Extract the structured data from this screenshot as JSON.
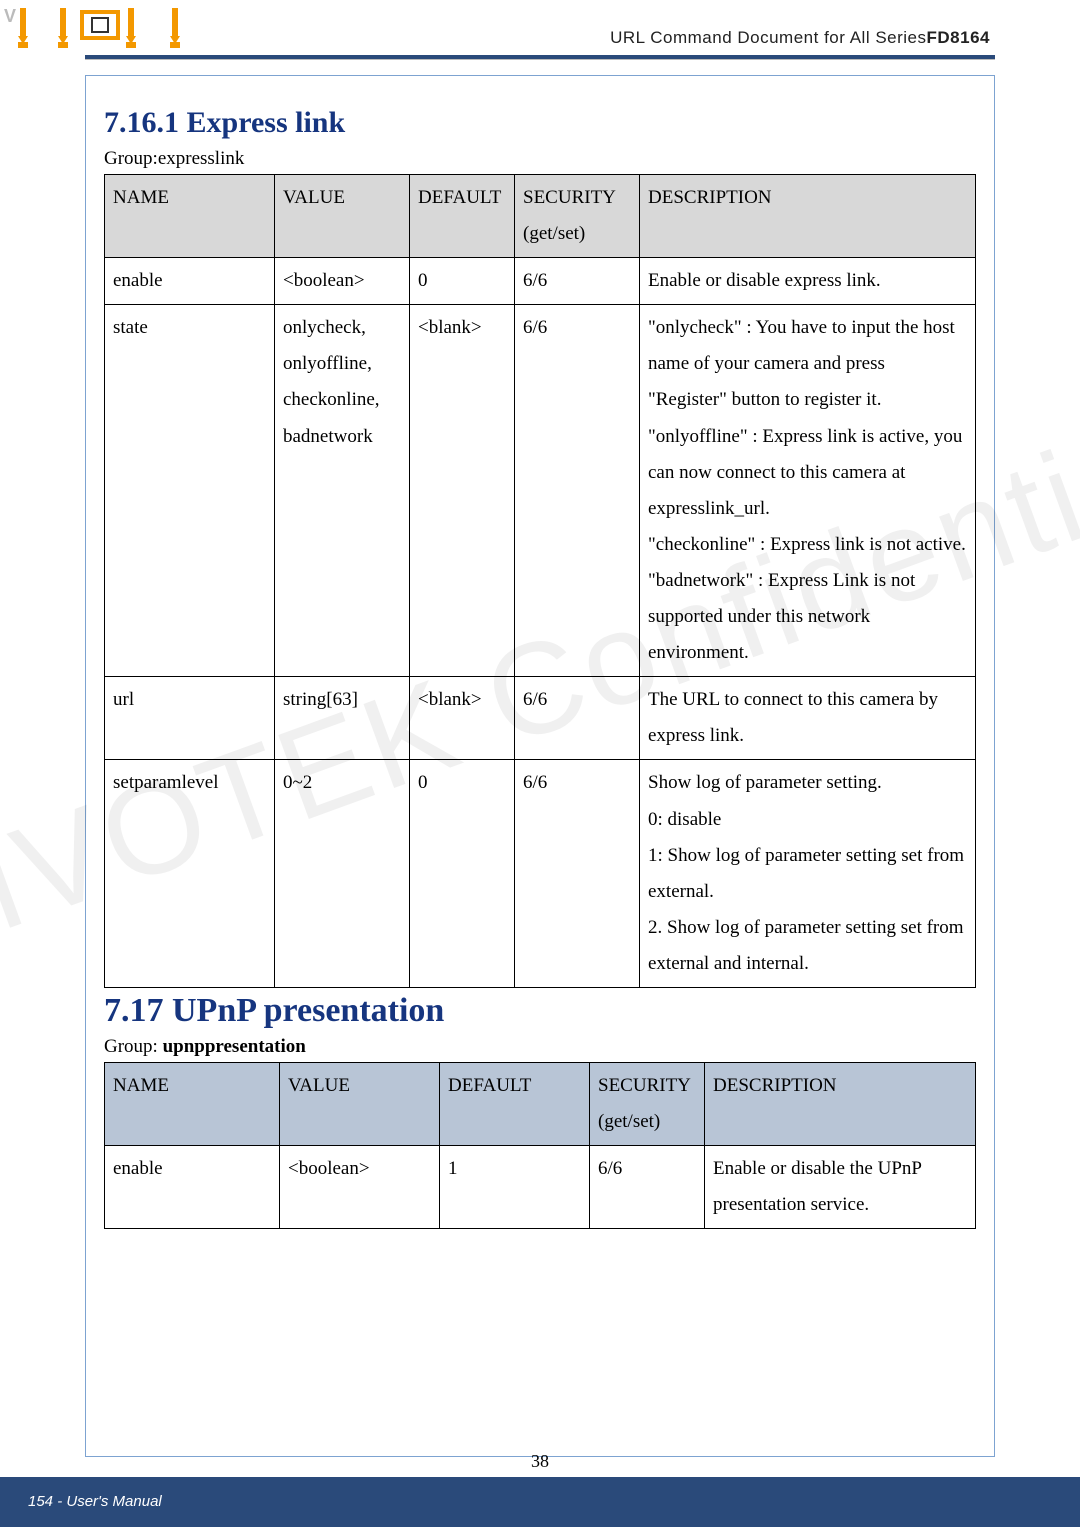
{
  "header": {
    "doc_title_prefix": "URL Command Document for ",
    "doc_title_series": "All Series",
    "doc_title_model": "FD8164"
  },
  "watermark": "VIVOTEK Confidential",
  "section1": {
    "title": "7.16.1 Express link",
    "group_prefix": "Group:",
    "group_name": "expresslink",
    "headers": [
      "NAME",
      "VALUE",
      "DEFAULT",
      "SECURITY (get/set)",
      "DESCRIPTION"
    ],
    "rows": [
      {
        "name": "enable",
        "value": "<boolean>",
        "default": "0",
        "security": "6/6",
        "description": "Enable or disable express link."
      },
      {
        "name": "state",
        "value": "onlycheck, onlyoffline, checkonline, badnetwork",
        "default": "<blank>",
        "security": "6/6",
        "description": "\"onlycheck\" : You have to input the host name of your camera and press \"Register\" button to register it. \"onlyoffline\" : Express link is active, you can now connect to this camera at expresslink_url. \"checkonline\" : Express link is not active. \"badnetwork\" : Express Link is not supported under this network environment."
      },
      {
        "name": "url",
        "value": "string[63]",
        "default": "<blank>",
        "security": "6/6",
        "description": "The URL to connect to this camera by express link."
      },
      {
        "name": "setparamlevel",
        "value": "0~2",
        "default": "0",
        "security": "6/6",
        "description": "Show log of parameter setting. 0: disable 1: Show log of parameter setting set from external. 2. Show log of parameter setting set from external and internal."
      }
    ]
  },
  "section2": {
    "title": "7.17 UPnP presentation",
    "group_prefix": "Group: ",
    "group_name": "upnppresentation",
    "headers": [
      "NAME",
      "VALUE",
      "DEFAULT",
      "SECURITY (get/set)",
      "DESCRIPTION"
    ],
    "rows": [
      {
        "name": "enable",
        "value": "<boolean>",
        "default": "1",
        "security": "6/6",
        "description": "Enable or disable the UPnP presentation service."
      }
    ]
  },
  "footer": {
    "left": "154 - User's Manual",
    "page_number": "38"
  }
}
